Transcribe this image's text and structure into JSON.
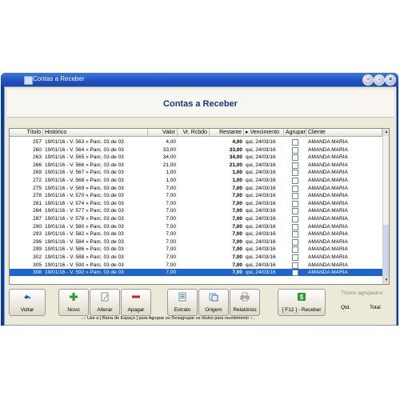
{
  "window": {
    "title": "Contas a Receber"
  },
  "page": {
    "title": "Contas a Receber"
  },
  "columns": {
    "titulo": "Título",
    "historico": "Histórico",
    "valor": "Valor",
    "recebido": "Vr. Rcbdo",
    "restante": "Restante",
    "vencimento": "▸ Vencimento",
    "agrupar": "Agrupar",
    "cliente": "Cliente"
  },
  "rows": [
    {
      "titulo": "257",
      "historico": "19/01/16 - V. 563 » Parc. 03 de 03",
      "valor": "4,00",
      "restante": "4,00",
      "vencimento": "qui, 24/03/16",
      "cliente": "AMANDA MARIA"
    },
    {
      "titulo": "260",
      "historico": "19/01/16 - V. 564 » Parc. 03 de 03",
      "valor": "33,00",
      "restante": "33,00",
      "vencimento": "qui, 24/03/16",
      "cliente": "AMANDA MARIA"
    },
    {
      "titulo": "263",
      "historico": "19/01/16 - V. 565 » Parc. 03 de 03",
      "valor": "34,00",
      "restante": "34,00",
      "vencimento": "qui, 24/03/16",
      "cliente": "AMANDA MARIA"
    },
    {
      "titulo": "266",
      "historico": "19/01/16 - V. 566 » Parc. 03 de 03",
      "valor": "21,00",
      "restante": "21,00",
      "vencimento": "qui, 24/03/16",
      "cliente": "AMANDA MARIA"
    },
    {
      "titulo": "269",
      "historico": "19/01/16 - V. 567 » Parc. 03 de 03",
      "valor": "1,00",
      "restante": "1,00",
      "vencimento": "qui, 24/03/16",
      "cliente": "AMANDA MARIA"
    },
    {
      "titulo": "272",
      "historico": "19/01/16 - V. 568 » Parc. 03 de 03",
      "valor": "1,00",
      "restante": "1,00",
      "vencimento": "qui, 24/03/16",
      "cliente": "AMANDA MARIA"
    },
    {
      "titulo": "275",
      "historico": "19/01/16 - V. 569 » Parc. 03 de 03",
      "valor": "7,00",
      "restante": "7,00",
      "vencimento": "qui, 24/03/16",
      "cliente": "AMANDA MARIA"
    },
    {
      "titulo": "278",
      "historico": "19/01/16 - V. 570 » Parc. 03 de 03",
      "valor": "7,00",
      "restante": "7,00",
      "vencimento": "qui, 24/03/16",
      "cliente": "AMANDA MARIA"
    },
    {
      "titulo": "281",
      "historico": "19/01/16 - V. 574 » Parc. 03 de 03",
      "valor": "7,00",
      "restante": "7,00",
      "vencimento": "qui, 24/03/16",
      "cliente": "AMANDA MARIA"
    },
    {
      "titulo": "284",
      "historico": "19/01/16 - V. 577 » Parc. 03 de 03",
      "valor": "7,00",
      "restante": "7,00",
      "vencimento": "qui, 24/03/16",
      "cliente": "AMANDA MARIA"
    },
    {
      "titulo": "287",
      "historico": "19/01/16 - V. 578 » Parc. 03 de 03",
      "valor": "7,00",
      "restante": "7,00",
      "vencimento": "qui, 24/03/16",
      "cliente": "AMANDA MARIA"
    },
    {
      "titulo": "290",
      "historico": "19/01/16 - V. 580 » Parc. 03 de 03",
      "valor": "7,00",
      "restante": "7,00",
      "vencimento": "qui, 24/03/16",
      "cliente": "AMANDA MARIA"
    },
    {
      "titulo": "293",
      "historico": "19/01/16 - V. 582 » Parc. 03 de 03",
      "valor": "7,00",
      "restante": "7,00",
      "vencimento": "qui, 24/03/16",
      "cliente": "AMANDA MARIA"
    },
    {
      "titulo": "296",
      "historico": "19/01/16 - V. 584 » Parc. 03 de 03",
      "valor": "7,00",
      "restante": "7,00",
      "vencimento": "qui, 24/03/16",
      "cliente": "AMANDA MARIA"
    },
    {
      "titulo": "299",
      "historico": "19/01/16 - V. 586 » Parc. 03 de 03",
      "valor": "7,00",
      "restante": "7,00",
      "vencimento": "qui, 24/03/16",
      "cliente": "AMANDA MARIA"
    },
    {
      "titulo": "302",
      "historico": "19/01/16 - V. 588 » Parc. 03 de 03",
      "valor": "7,00",
      "restante": "7,00",
      "vencimento": "qui, 24/03/16",
      "cliente": "AMANDA MARIA"
    },
    {
      "titulo": "305",
      "historico": "19/01/16 - V. 590 » Parc. 03 de 03",
      "valor": "7,00",
      "restante": "7,00",
      "vencimento": "qui, 24/03/16",
      "cliente": "AMANDA MARIA"
    },
    {
      "titulo": "308",
      "historico": "19/01/16 - V. 592 » Parc. 03 de 03",
      "valor": "7,00",
      "restante": "7,00",
      "vencimento": "qui, 24/03/16",
      "cliente": "AMANDA MARIA",
      "selected": true
    }
  ],
  "toolbar": {
    "voltar": "Voltar",
    "novo": "Novo",
    "alterar": "Alterar",
    "apagar": "Apagar",
    "extrato": "Extrato",
    "origem": "Origem",
    "relatorios": "Relatórios",
    "receber": "[ F12 ] - Receber"
  },
  "summary": {
    "title": "Títulos agrupados:",
    "qtd": "Qtd.",
    "total": "Total"
  },
  "status": {
    "text": "..:: Use a [ Barra de Espaço ] para Agrupar ou Desagrupar os títulos para recebimento ::.."
  },
  "colors": {
    "accent": "#173a8c",
    "selection": "#1c64cf",
    "titlebar": "#2356c4"
  },
  "icons": [
    "back-arrow-icon",
    "plus-icon",
    "edit-icon",
    "minus-icon",
    "statement-icon",
    "origin-icon",
    "printer-icon",
    "money-icon",
    "minimize-icon",
    "restore-icon",
    "close-icon"
  ]
}
